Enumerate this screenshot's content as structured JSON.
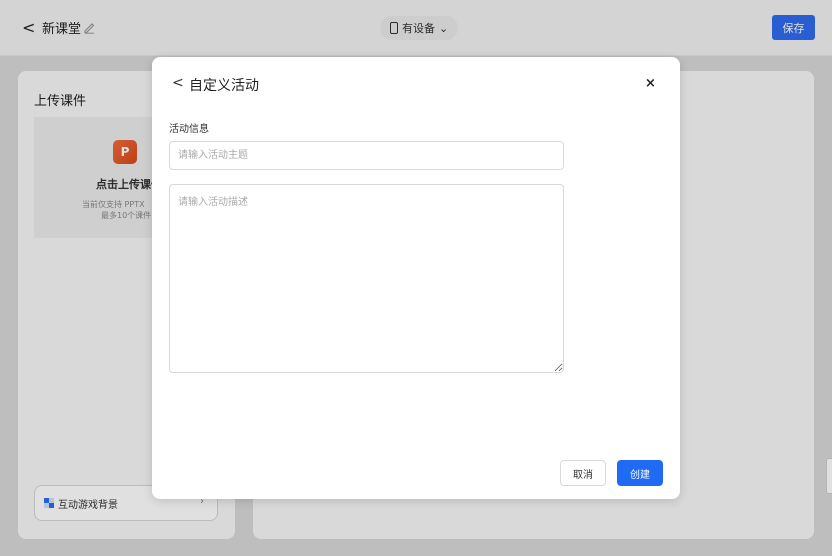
{
  "topbar": {
    "back_glyph": "<",
    "title": "新课堂",
    "edit_icon": "pencil-icon",
    "device_label": "有设备",
    "device_chevron": "⌄",
    "save_label": "保存"
  },
  "left_panel": {
    "title": "上传课件",
    "upload": {
      "icon": "powerpoint-icon",
      "icon_letter": "P",
      "title": "点击上传课件",
      "desc_line1": "当前仅支持 PPTX",
      "desc_line2": "最多10个课件"
    },
    "game_background": {
      "icon": "grid-icon",
      "label": "互动游戏背景",
      "chevron": "›"
    }
  },
  "modal": {
    "back_glyph": "<",
    "title": "自定义活动",
    "close_glyph": "×",
    "section_label": "活动信息",
    "topic": {
      "value": "",
      "placeholder": "请输入活动主题"
    },
    "description": {
      "value": "",
      "placeholder": "请输入活动描述"
    },
    "cancel_label": "取消",
    "create_label": "创建"
  },
  "colors": {
    "primary": "#1f6bf5",
    "save_button": "#2f6bf0",
    "ppt_orange": "#e85a2a",
    "overlay": "rgba(0,0,0,0.12)"
  }
}
